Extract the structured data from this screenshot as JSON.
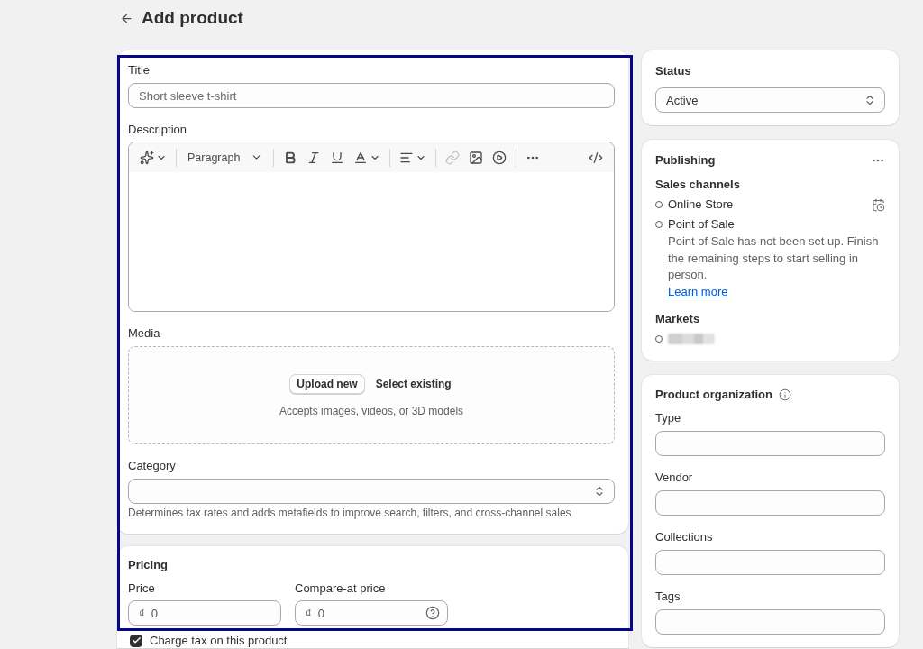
{
  "page": {
    "title": "Add product"
  },
  "main": {
    "highlighted": true,
    "title_field": {
      "label": "Title",
      "placeholder": "Short sleeve t-shirt"
    },
    "description": {
      "label": "Description",
      "toolbar": {
        "groups": [
          {
            "tools": [
              {
                "kind": "ai",
                "dropdown": true,
                "disabled": false
              }
            ]
          },
          {
            "tools": [
              {
                "kind": "format",
                "label": "Paragraph",
                "dropdown": true,
                "disabled": false
              }
            ]
          },
          {
            "tools": [
              {
                "kind": "bold",
                "dropdown": false,
                "disabled": false
              },
              {
                "kind": "italic",
                "dropdown": false,
                "disabled": false
              },
              {
                "kind": "underline",
                "dropdown": false,
                "disabled": false
              },
              {
                "kind": "color",
                "dropdown": true,
                "disabled": false
              }
            ]
          },
          {
            "tools": [
              {
                "kind": "align",
                "dropdown": true,
                "disabled": false
              }
            ]
          },
          {
            "tools": [
              {
                "kind": "link",
                "dropdown": false,
                "disabled": true
              },
              {
                "kind": "image",
                "dropdown": false,
                "disabled": false
              },
              {
                "kind": "video",
                "dropdown": false,
                "disabled": false
              }
            ]
          },
          {
            "tools": [
              {
                "kind": "more",
                "dropdown": false,
                "disabled": false
              }
            ]
          }
        ],
        "end_tools": [
          {
            "kind": "code",
            "dropdown": false,
            "disabled": false
          }
        ]
      }
    },
    "media": {
      "label": "Media",
      "upload_button": "Upload new",
      "select_button": "Select existing",
      "hint": "Accepts images, videos, or 3D models"
    },
    "category": {
      "label": "Category",
      "help": "Determines tax rates and adds metafields to improve search, filters, and cross-channel sales"
    },
    "pricing": {
      "title": "Pricing",
      "fields": [
        {
          "label": "Price",
          "currency": "₫",
          "placeholder": "0",
          "help_icon": false
        },
        {
          "label": "Compare-at price",
          "currency": "₫",
          "placeholder": "0",
          "help_icon": true
        }
      ],
      "charge_tax": {
        "label": "Charge tax on this product",
        "checked": true
      }
    }
  },
  "sidebar": {
    "status": {
      "title": "Status",
      "value": "Active"
    },
    "publishing": {
      "title": "Publishing",
      "sales_channels": {
        "label": "Sales channels",
        "items": [
          {
            "name": "Online Store",
            "schedule_icon": true
          },
          {
            "name": "Point of Sale",
            "schedule_icon": false,
            "note": "Point of Sale has not been set up. Finish the remaining steps to start selling in person.",
            "link": "Learn more"
          }
        ]
      },
      "markets": {
        "label": "Markets",
        "items": [
          {
            "blurred": true
          }
        ]
      }
    },
    "organization": {
      "title": "Product organization",
      "fields": [
        {
          "label": "Type"
        },
        {
          "label": "Vendor"
        },
        {
          "label": "Collections"
        },
        {
          "label": "Tags"
        }
      ]
    }
  }
}
